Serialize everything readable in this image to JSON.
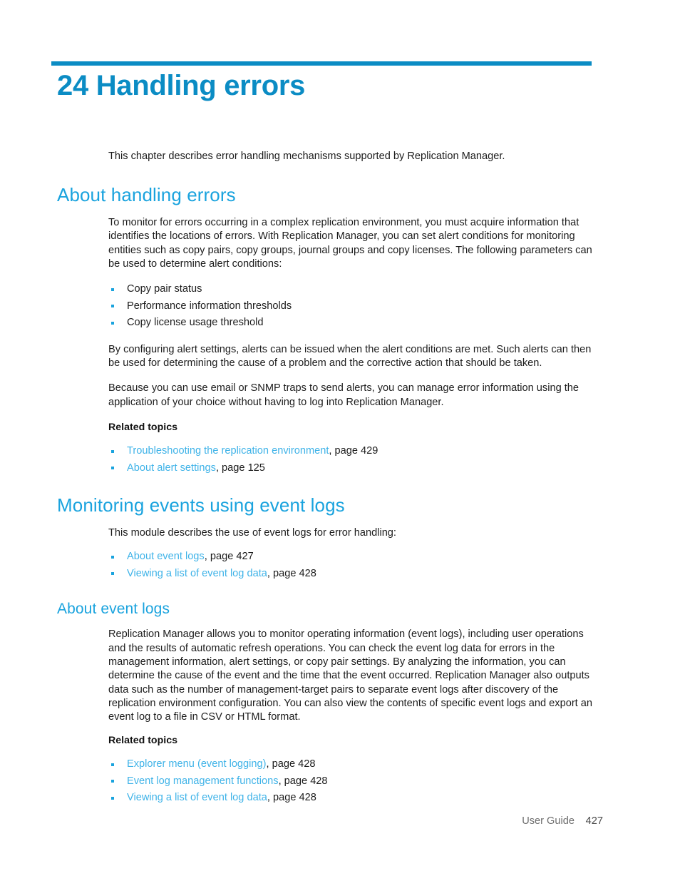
{
  "chapter": {
    "number": "24",
    "title": "24 Handling errors",
    "intro": "This chapter describes error handling mechanisms supported by Replication Manager."
  },
  "sections": [
    {
      "heading": "About handling errors",
      "paragraphs": [
        "To monitor for errors occurring in a complex replication environment, you must acquire information that identifies the locations of errors. With Replication Manager, you can set alert conditions for monitoring entities such as copy pairs, copy groups, journal groups and copy licenses. The following parameters can be used to determine alert conditions:"
      ],
      "bullets": [
        "Copy pair status",
        "Performance information thresholds",
        "Copy license usage threshold"
      ],
      "paragraphs_after": [
        "By configuring alert settings, alerts can be issued when the alert conditions are met. Such alerts can then be used for determining the cause of a problem and the corrective action that should be taken.",
        "Because you can use email or SNMP traps to send alerts, you can manage error information using the application of your choice without having to log into Replication Manager."
      ],
      "related_label": "Related topics",
      "related": [
        {
          "link": "Troubleshooting the replication environment",
          "page": ", page 429"
        },
        {
          "link": "About alert settings",
          "page": ", page 125"
        }
      ]
    },
    {
      "heading": "Monitoring events using event logs",
      "intro": "This module describes the use of event logs for error handling:",
      "links": [
        {
          "link": "About event logs",
          "page": ", page 427"
        },
        {
          "link": "Viewing a list of event log data",
          "page": ", page 428"
        }
      ],
      "subsection": {
        "heading": "About event logs",
        "paragraph": "Replication Manager allows you to monitor operating information (event logs), including user operations and the results of automatic refresh operations. You can check the event log data for errors in the management information, alert settings, or copy pair settings. By analyzing the information, you can determine the cause of the event and the time that the event occurred. Replication Manager also outputs data such as the number of management-target pairs to separate event logs after discovery of the replication environment configuration. You can also view the contents of specific event logs and export an event log to a file in CSV or HTML format.",
        "related_label": "Related topics",
        "related": [
          {
            "link": "Explorer menu (event logging)",
            "page": ", page 428"
          },
          {
            "link": "Event log management functions",
            "page": ", page 428"
          },
          {
            "link": "Viewing a list of event log data",
            "page": ", page 428"
          }
        ]
      }
    }
  ],
  "footer": {
    "guide": "User Guide",
    "page_number": "427"
  },
  "colors": {
    "rule": "#0b8cc4",
    "chapter_title": "#0b8cc4",
    "heading": "#1aa3de",
    "link": "#3fb3e8",
    "body": "#1c1c1c",
    "footer": "#6d6d6d"
  }
}
